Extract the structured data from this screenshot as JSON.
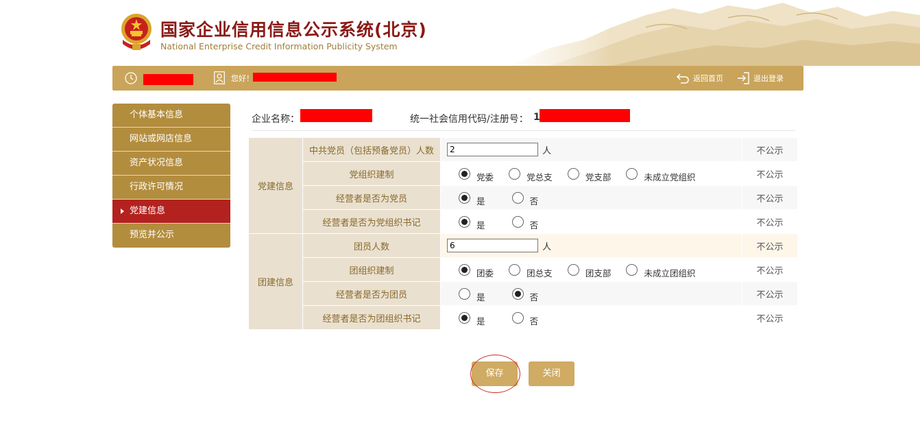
{
  "header": {
    "title_cn": "国家企业信用信息公示系统(北京)",
    "title_en": "National Enterprise Credit Information Publicity System"
  },
  "topbar": {
    "greeting": "您好！",
    "home_link": "返回首页",
    "logout_link": "退出登录"
  },
  "sidebar": {
    "items": [
      {
        "label": "个体基本信息",
        "active": false
      },
      {
        "label": "网站或网店信息",
        "active": false
      },
      {
        "label": "资产状况信息",
        "active": false
      },
      {
        "label": "行政许可情况",
        "active": false
      },
      {
        "label": "党建信息",
        "active": true
      },
      {
        "label": "预览并公示",
        "active": false
      }
    ]
  },
  "company": {
    "name_label": "企业名称：",
    "code_label": "统一社会信用代码/注册号：",
    "code_prefix": "1"
  },
  "form": {
    "party_group": "党建信息",
    "league_group": "团建信息",
    "publish_label": "不公示",
    "rows": [
      {
        "label": "中共党员（包括预备党员）人数",
        "type": "number",
        "value": "2",
        "unit": "人"
      },
      {
        "label": "党组织建制",
        "type": "radio",
        "options": [
          "党委",
          "党总支",
          "党支部",
          "未成立党组织"
        ],
        "selected": 0
      },
      {
        "label": "经营者是否为党员",
        "type": "radio",
        "options": [
          "是",
          "否"
        ],
        "selected": 0
      },
      {
        "label": "经营者是否为党组织书记",
        "type": "radio",
        "options": [
          "是",
          "否"
        ],
        "selected": 0
      },
      {
        "label": "团员人数",
        "type": "number",
        "value": "6",
        "unit": "人"
      },
      {
        "label": "团组织建制",
        "type": "radio",
        "options": [
          "团委",
          "团总支",
          "团支部",
          "未成立团组织"
        ],
        "selected": 0
      },
      {
        "label": "经营者是否为团员",
        "type": "radio",
        "options": [
          "是",
          "否"
        ],
        "selected": 1
      },
      {
        "label": "经营者是否为团组织书记",
        "type": "radio",
        "options": [
          "是",
          "否"
        ],
        "selected": 0
      }
    ]
  },
  "buttons": {
    "save": "保存",
    "close": "关闭"
  },
  "colors": {
    "gold": "#c9a45a",
    "sidebar_gold": "#b38d3e",
    "active_red": "#b3221f",
    "label_bg": "#e9e0d0",
    "label_text": "#8a6a2a",
    "button_gold": "#cfab64",
    "annotation_red": "#d22a22"
  }
}
